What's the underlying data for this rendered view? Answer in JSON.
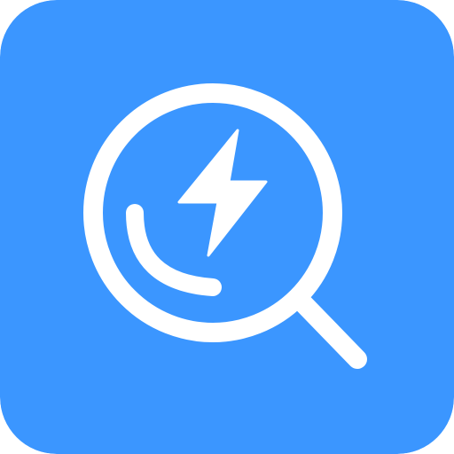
{
  "icon": {
    "name": "search-lightning-icon",
    "background_color": "#3B96FF",
    "glyph_color": "#FFFFFF"
  }
}
